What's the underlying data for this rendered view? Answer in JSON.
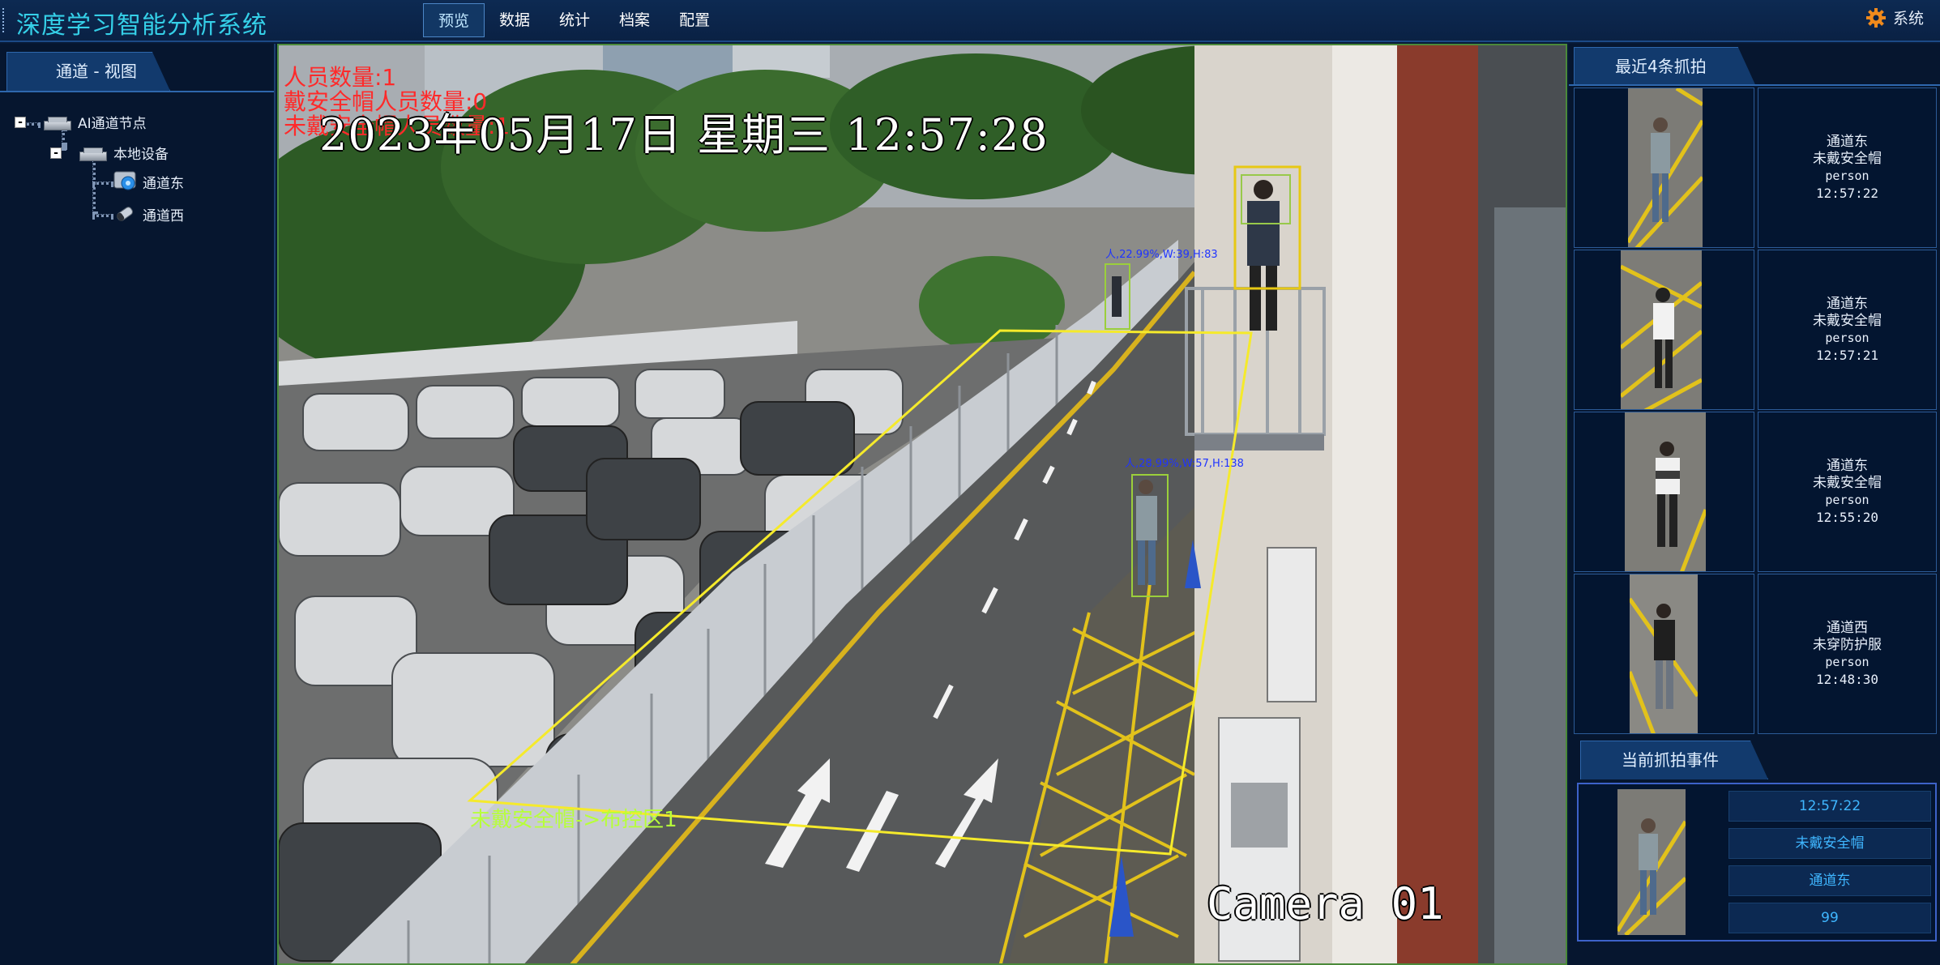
{
  "header": {
    "title": "深度学习智能分析系统",
    "menu": [
      "预览",
      "数据",
      "统计",
      "档案",
      "配置"
    ],
    "active_menu": "预览",
    "system_label": "系统",
    "system_icon": "gear-icon"
  },
  "left_panel": {
    "tab": "通道 - 视图",
    "tree": {
      "root": "AI通道节点",
      "device": "本地设备",
      "channels": [
        "通道东",
        "通道西"
      ]
    }
  },
  "video": {
    "osd_lines": [
      "人员数量:1",
      "戴安全帽人员数量:0",
      "未戴安全帽人员数量:1"
    ],
    "datetime": "2023年05月17日  星期三  12:57:28",
    "detections": [
      "人,22.99%,W:39,H:83",
      "人,28.99%,W:57,H:138"
    ],
    "zone_label": "未戴安全帽->布控区1",
    "camera_label": "Camera 01"
  },
  "right_panel": {
    "recent_title": "最近4条抓拍",
    "recent": [
      {
        "channel": "通道东",
        "event": "未戴安全帽",
        "object": "person",
        "time": "12:57:22"
      },
      {
        "channel": "通道东",
        "event": "未戴安全帽",
        "object": "person",
        "time": "12:57:21"
      },
      {
        "channel": "通道东",
        "event": "未戴安全帽",
        "object": "person",
        "time": "12:55:20"
      },
      {
        "channel": "通道西",
        "event": "未穿防护服",
        "object": "person",
        "time": "12:48:30"
      }
    ],
    "current_title": "当前抓拍事件",
    "current": {
      "time": "12:57:22",
      "event": "未戴安全帽",
      "channel": "通道东",
      "value": "99"
    }
  },
  "colors": {
    "background": "#081a36",
    "title": "#35d0e8",
    "accent_border": "#2c5b97",
    "osd_alarm": "#ff2a2a",
    "zone_line": "#f5ea2b",
    "zone_label": "#b7ff3a",
    "field_text": "#3fb6ff"
  }
}
